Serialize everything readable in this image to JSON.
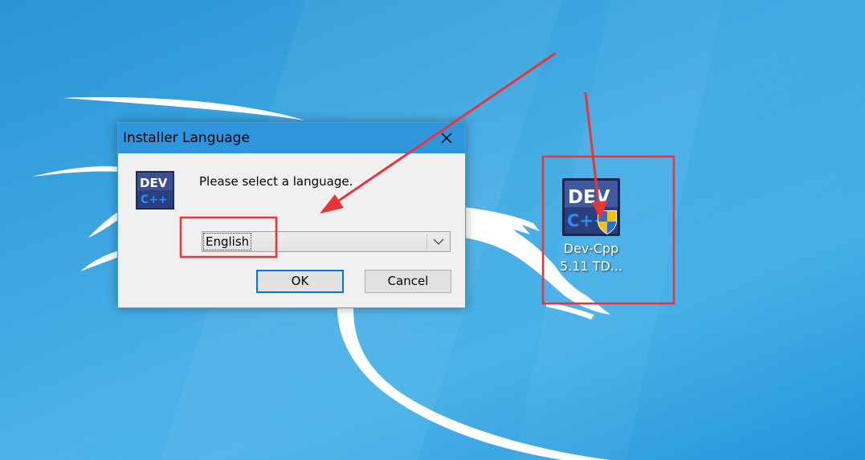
{
  "dialog": {
    "title": "Installer Language",
    "close_icon": "close-icon",
    "app_icon": "dev-cpp-icon",
    "prompt": "Please select a language.",
    "language_select": {
      "value": "English"
    },
    "ok_label": "OK",
    "cancel_label": "Cancel"
  },
  "desktop": {
    "icon": {
      "name": "dev-cpp-installer-icon",
      "label_line1": "Dev-Cpp",
      "label_line2": "5.11 TD..."
    }
  },
  "colors": {
    "titlebar": "#2f95dd",
    "annotation": "#e8353b",
    "desktop_bg": "#2a9fe0"
  }
}
